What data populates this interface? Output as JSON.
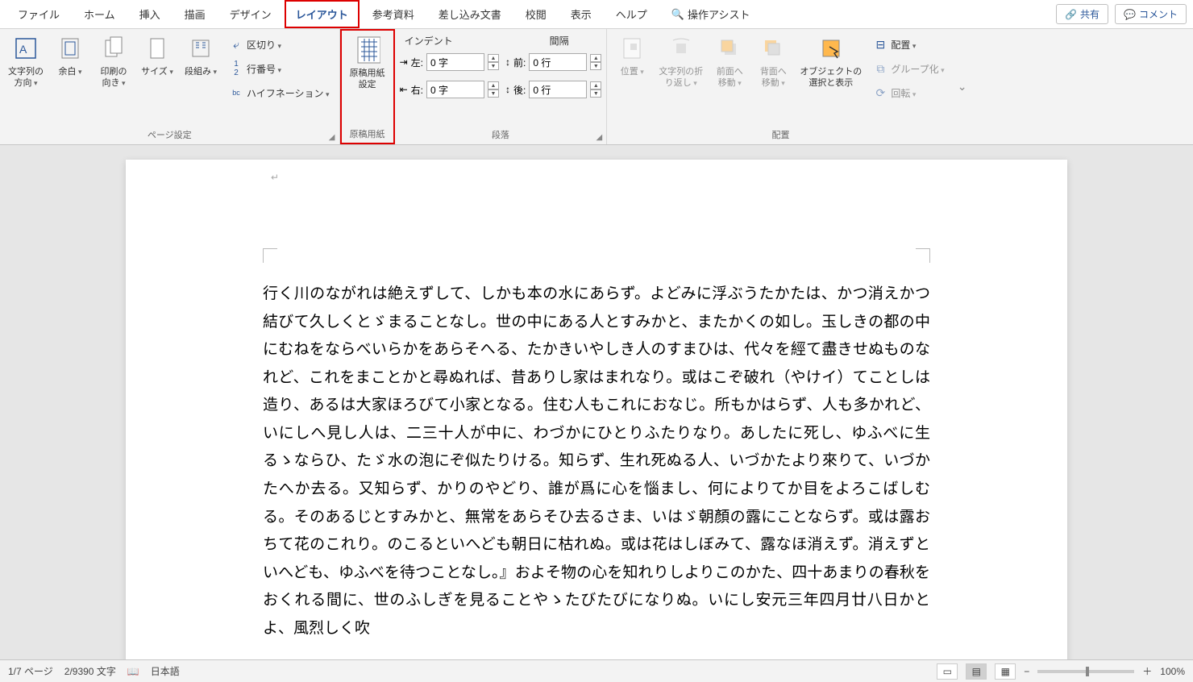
{
  "tabs": {
    "file": "ファイル",
    "home": "ホーム",
    "insert": "挿入",
    "draw": "描画",
    "design": "デザイン",
    "layout": "レイアウト",
    "references": "参考資料",
    "mailings": "差し込み文書",
    "review": "校閲",
    "view": "表示",
    "help": "ヘルプ",
    "tellme": "操作アシスト",
    "share": "共有",
    "comments": "コメント"
  },
  "pageSetup": {
    "groupLabel": "ページ設定",
    "textDirection": "文字列の\n方向",
    "margins": "余白",
    "orientation": "印刷の\n向き",
    "size": "サイズ",
    "columns": "段組み",
    "breaks": "区切り",
    "lineNumbers": "行番号",
    "hyphenation": "ハイフネーション"
  },
  "manuscript": {
    "groupLabel": "原稿用紙",
    "button": "原稿用紙\n設定"
  },
  "paragraph": {
    "groupLabel": "段落",
    "indentHeader": "インデント",
    "spacingHeader": "間隔",
    "leftLabel": "左:",
    "rightLabel": "右:",
    "beforeLabel": "前:",
    "afterLabel": "後:",
    "leftVal": "0 字",
    "rightVal": "0 字",
    "beforeVal": "0 行",
    "afterVal": "0 行"
  },
  "arrange": {
    "groupLabel": "配置",
    "position": "位置",
    "wrap": "文字列の折\nり返し",
    "bringForward": "前面へ\n移動",
    "sendBackward": "背面へ\n移動",
    "selectionPane": "オブジェクトの\n選択と表示",
    "align": "配置",
    "group": "グループ化",
    "rotate": "回転"
  },
  "document": {
    "text": "行く川のながれは絶えずして、しかも本の水にあらず。よどみに浮ぶうたかたは、かつ消えかつ結びて久しくとゞまることなし。世の中にある人とすみかと、またかくの如し。玉しきの都の中にむねをならべいらかをあらそへる、たかきいやしき人のすまひは、代々を經て盡きせぬものなれど、これをまことかと尋ぬれば、昔ありし家はまれなり。或はこぞ破れ（やけイ）てことしは造り、あるは大家ほろびて小家となる。住む人もこれにおなじ。所もかはらず、人も多かれど、いにしへ見し人は、二三十人が中に、わづかにひとりふたりなり。あしたに死し、ゆふべに生るゝならひ、たゞ水の泡にぞ似たりける。知らず、生れ死ぬる人、いづかたより來りて、いづかたへか去る。又知らず、かりのやどり、誰が爲に心を惱まし、何によりてか目をよろこばしむる。そのあるじとすみかと、無常をあらそひ去るさま、いはゞ朝顏の露にことならず。或は露おちて花のこれり。のこるといへども朝日に枯れぬ。或は花はしぼみて、露なほ消えず。消えずといへども、ゆふべを待つことなし。』およそ物の心を知れりしよりこのかた、四十あまりの春秋をおくれる間に、世のふしぎを見ることやゝたびたびになりぬ。いにし安元三年四月廿八日かとよ、風烈しく吹"
  },
  "status": {
    "page": "1/7 ページ",
    "words": "2/9390 文字",
    "lang": "日本語",
    "zoom": "100%"
  }
}
